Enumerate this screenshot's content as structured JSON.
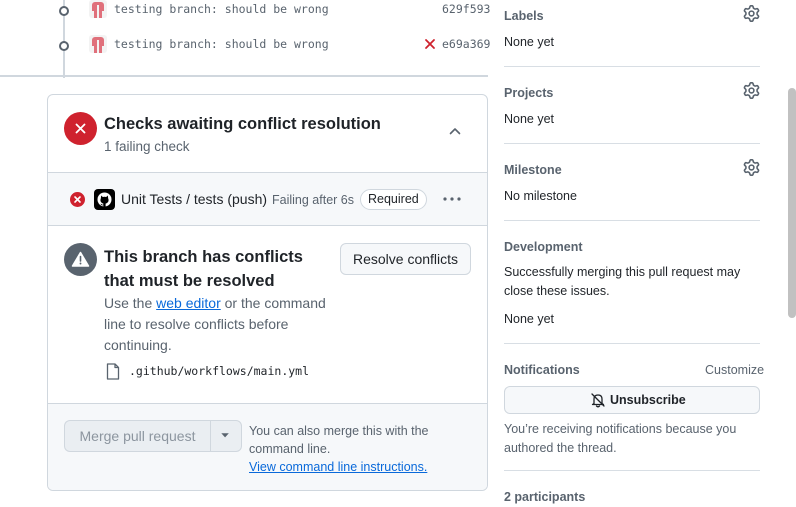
{
  "commits": [
    {
      "message": "testing branch: should be wrong",
      "sha": "629f593",
      "failed": false
    },
    {
      "message": "testing branch: should be wrong",
      "sha": "e69a369",
      "failed": true
    }
  ],
  "checks": {
    "title": "Checks awaiting conflict resolution",
    "subtitle": "1 failing check",
    "items": [
      {
        "name": "Unit Tests / tests (push)",
        "status": "Failing after 6s",
        "badge": "Required"
      }
    ]
  },
  "conflicts": {
    "title": "This branch has conflicts that must be resolved",
    "desc_before": "Use the ",
    "desc_link": "web editor",
    "desc_after": " or the command line to resolve conflicts before continuing.",
    "resolve_button": "Resolve conflicts",
    "file": ".github/workflows/main.yml"
  },
  "merge": {
    "button": "Merge pull request",
    "hint": "You can also merge this with the command line.",
    "hint_link": "View command line instructions."
  },
  "sidebar": {
    "labels": {
      "heading": "Labels",
      "value": "None yet"
    },
    "projects": {
      "heading": "Projects",
      "value": "None yet"
    },
    "milestone": {
      "heading": "Milestone",
      "value": "No milestone"
    },
    "development": {
      "heading": "Development",
      "text": "Successfully merging this pull request may close these issues.",
      "value": "None yet"
    },
    "notifications": {
      "heading": "Notifications",
      "customize": "Customize",
      "button": "Unsubscribe",
      "note": "You’re receiving notifications because you authored the thread."
    },
    "participants": {
      "heading": "2 participants"
    }
  },
  "colors": {
    "danger": "#cf222e",
    "link": "#0969da",
    "muted": "#59636e",
    "border": "#d0d7de"
  }
}
